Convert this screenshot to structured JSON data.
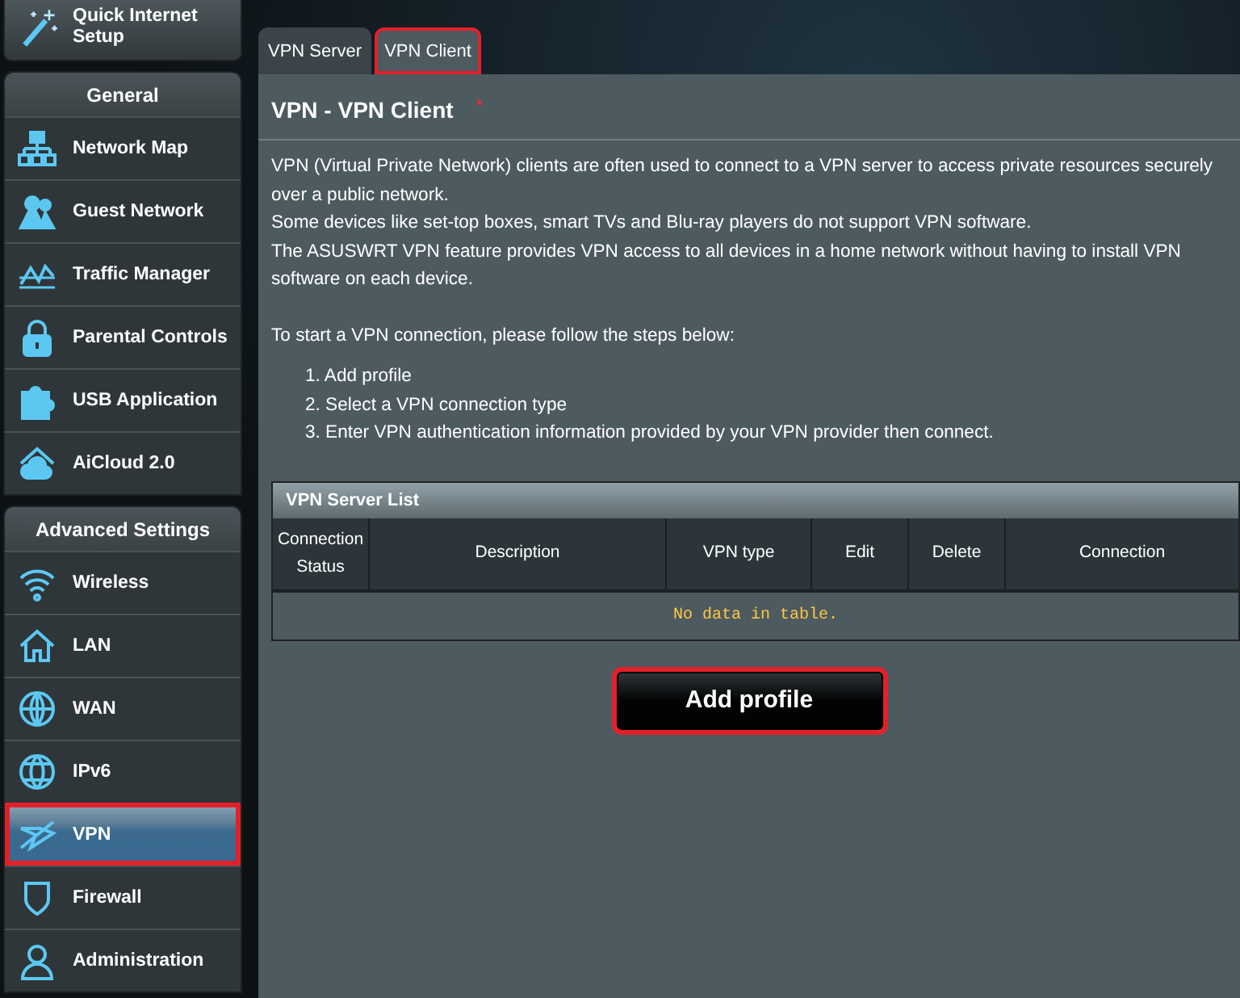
{
  "quick_setup": {
    "label": "Quick Internet Setup"
  },
  "sidebar": {
    "sections": [
      {
        "title": "General",
        "items": [
          {
            "label": "Network Map",
            "selected": false,
            "highlighted": false
          },
          {
            "label": "Guest Network",
            "selected": false,
            "highlighted": false
          },
          {
            "label": "Traffic Manager",
            "selected": false,
            "highlighted": false
          },
          {
            "label": "Parental Controls",
            "selected": false,
            "highlighted": false
          },
          {
            "label": "USB Application",
            "selected": false,
            "highlighted": false
          },
          {
            "label": "AiCloud 2.0",
            "selected": false,
            "highlighted": false
          }
        ]
      },
      {
        "title": "Advanced Settings",
        "items": [
          {
            "label": "Wireless",
            "selected": false,
            "highlighted": false
          },
          {
            "label": "LAN",
            "selected": false,
            "highlighted": false
          },
          {
            "label": "WAN",
            "selected": false,
            "highlighted": false
          },
          {
            "label": "IPv6",
            "selected": false,
            "highlighted": false
          },
          {
            "label": "VPN",
            "selected": true,
            "highlighted": true
          },
          {
            "label": "Firewall",
            "selected": false,
            "highlighted": false
          },
          {
            "label": "Administration",
            "selected": false,
            "highlighted": false
          }
        ]
      }
    ]
  },
  "tabs": [
    {
      "label": "VPN Server",
      "selected": false,
      "highlighted": false
    },
    {
      "label": "VPN Client",
      "selected": true,
      "highlighted": true
    }
  ],
  "page": {
    "title": "VPN - VPN Client",
    "required_mark": "*",
    "paragraphs": [
      "VPN (Virtual Private Network) clients are often used to connect to a VPN server to access private resources securely over a public network.",
      "Some devices like set-top boxes, smart TVs and Blu-ray players do not support VPN software.",
      "The ASUSWRT VPN feature provides VPN access to all devices in a home network without having to install VPN software on each device."
    ],
    "steps_intro": "To start a VPN connection, please follow the steps below:",
    "steps": [
      "1. Add profile",
      "2. Select a VPN connection type",
      "3. Enter VPN authentication information provided by your VPN provider then connect."
    ]
  },
  "table": {
    "title": "VPN Server List",
    "columns": [
      "Connection Status",
      "Description",
      "VPN type",
      "Edit",
      "Delete",
      "Connection"
    ],
    "empty_message": "No data in table."
  },
  "add_button": {
    "label": "Add profile",
    "highlighted": true
  }
}
